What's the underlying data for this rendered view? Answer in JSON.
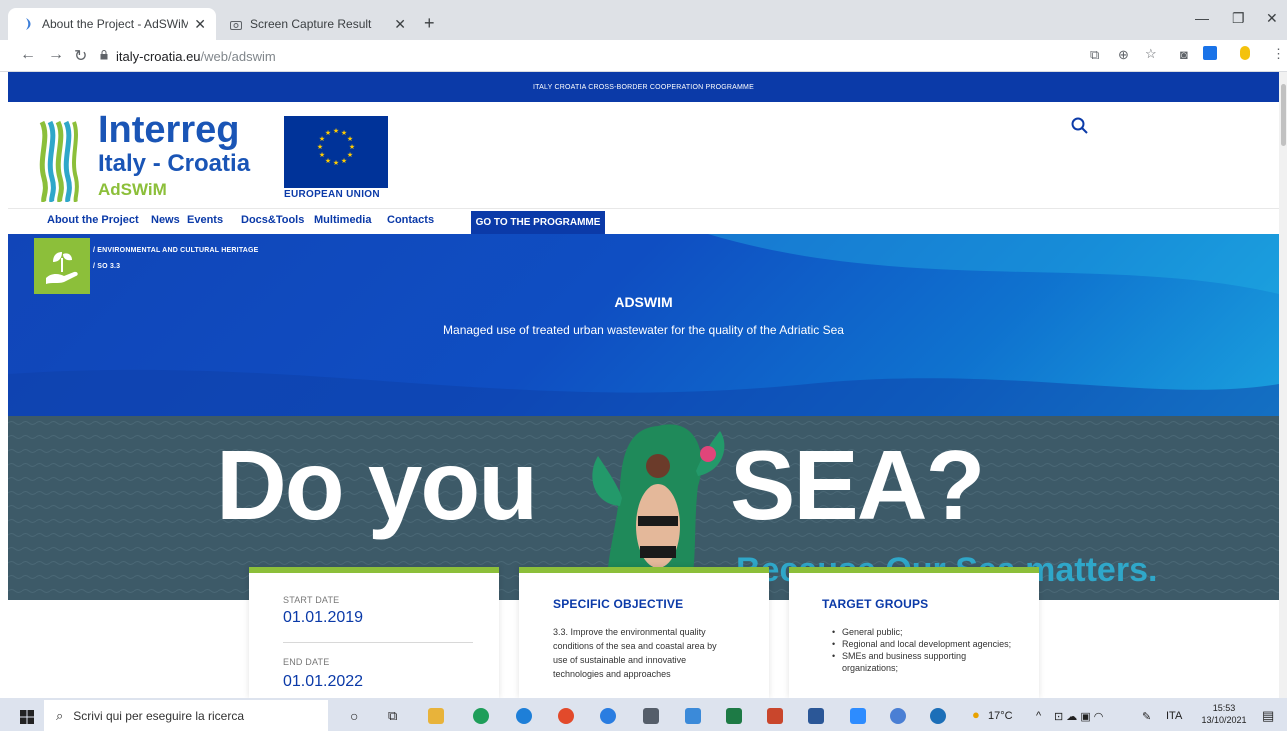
{
  "browser": {
    "tabs": [
      {
        "title": "About the Project - AdSWiM - Ita",
        "active": true
      },
      {
        "title": "Screen Capture Result",
        "active": false
      }
    ],
    "new_tab": "+",
    "url_domain": "italy-croatia.eu",
    "url_path": "/web/adswim",
    "window_controls": {
      "minimize": "—",
      "restore": "❐",
      "close": "✕"
    }
  },
  "site": {
    "top_banner": "ITALY CROATIA CROSS-BORDER COOPERATION PROGRAMME",
    "logo": {
      "title": "Interreg",
      "subtitle": "Italy - Croatia",
      "project": "AdSWiM"
    },
    "eu_label": "EUROPEAN UNION",
    "nav": [
      "About the Project",
      "News",
      "Events",
      "Docs&Tools",
      "Multimedia",
      "Contacts"
    ],
    "nav_program": "GO TO THE PROGRAMME",
    "breadcrumbs": [
      "/ ENVIRONMENTAL AND CULTURAL HERITAGE",
      "/ SO 3.3"
    ],
    "hero": {
      "title": "ADSWIM",
      "description": "Managed use of treated urban wastewater for the quality of the Adriatic Sea"
    },
    "banner": {
      "line1a": "Do you",
      "line1b": "SEA?",
      "line2": "Because Our Sea matters."
    },
    "cards": {
      "dates": {
        "start_label": "START DATE",
        "start": "01.01.2019",
        "end_label": "END DATE",
        "end": "01.01.2022"
      },
      "objective": {
        "title": "SPECIFIC OBJECTIVE",
        "lines": [
          "3.3. Improve the environmental quality",
          "conditions of the sea and coastal area by",
          "use of sustainable and innovative",
          "technologies and approaches"
        ]
      },
      "targets": {
        "title": "TARGET GROUPS",
        "items": [
          "General public;",
          "Regional and local development agencies;",
          "SMEs and business supporting organizations;"
        ]
      }
    }
  },
  "taskbar": {
    "search_placeholder": "Scrivi qui per eseguire la ricerca",
    "weather": "17°C",
    "language": "ITA",
    "time": "15:53",
    "date": "13/10/2021"
  },
  "colors": {
    "brand_blue": "#0b3aa8",
    "accent_green": "#8cbf3a",
    "banner_bg": "#3d5a68",
    "teal": "#2fa7c9"
  }
}
